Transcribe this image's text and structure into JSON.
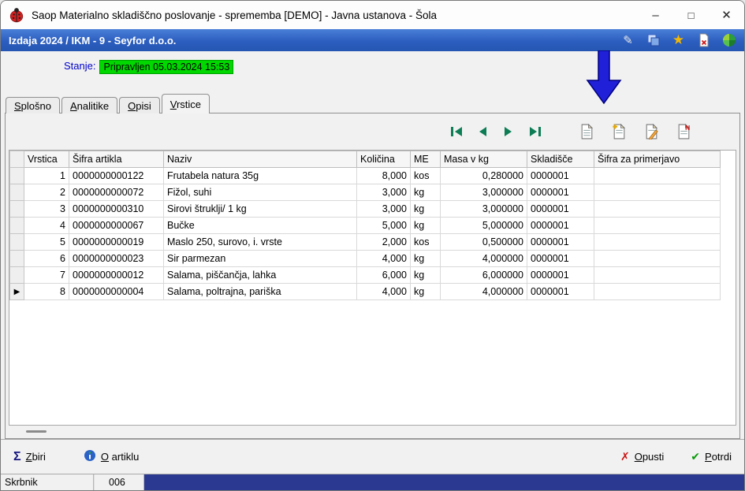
{
  "window": {
    "title": "Saop Materialno skladiščno poslovanje - sprememba [DEMO] - Javna ustanova - Šola",
    "controls": {
      "minimize": "–",
      "maximize": "□",
      "close": "✕"
    }
  },
  "header": {
    "title": "Izdaja 2024 / IKM - 9 - Seyfor d.o.o."
  },
  "state": {
    "label": "Stanje:",
    "value": "Pripravljen 05.03.2024 15:53"
  },
  "tabs": [
    {
      "label": "Splošno",
      "active": false
    },
    {
      "label": "Analitike",
      "active": false
    },
    {
      "label": "Opisi",
      "active": false
    },
    {
      "label": "Vrstice",
      "active": true
    }
  ],
  "table": {
    "columns": [
      {
        "label": "Vrstica",
        "align": "right"
      },
      {
        "label": "Šifra artikla",
        "align": "left"
      },
      {
        "label": "Naziv",
        "align": "left"
      },
      {
        "label": "Količina",
        "align": "right"
      },
      {
        "label": "ME",
        "align": "left"
      },
      {
        "label": "Masa v kg",
        "align": "right"
      },
      {
        "label": "Skladišče",
        "align": "left"
      },
      {
        "label": "Šifra za primerjavo",
        "align": "left"
      }
    ],
    "rows": [
      [
        "1",
        "0000000000122",
        "Frutabela natura 35g",
        "8,000",
        "kos",
        "0,280000",
        "0000001",
        ""
      ],
      [
        "2",
        "0000000000072",
        "Fižol, suhi",
        "3,000",
        "kg",
        "3,000000",
        "0000001",
        ""
      ],
      [
        "3",
        "0000000000310",
        "Sirovi štruklji/ 1 kg",
        "3,000",
        "kg",
        "3,000000",
        "0000001",
        ""
      ],
      [
        "4",
        "0000000000067",
        "Bučke",
        "5,000",
        "kg",
        "5,000000",
        "0000001",
        ""
      ],
      [
        "5",
        "0000000000019",
        "Maslo 250, surovo, i. vrste",
        "2,000",
        "kos",
        "0,500000",
        "0000001",
        ""
      ],
      [
        "6",
        "0000000000023",
        "Sir parmezan",
        "4,000",
        "kg",
        "4,000000",
        "0000001",
        ""
      ],
      [
        "7",
        "0000000000012",
        "Salama, piščančja, lahka",
        "6,000",
        "kg",
        "6,000000",
        "0000001",
        ""
      ],
      [
        "8",
        "0000000000004",
        "Salama, poltrajna, pariška",
        "4,000",
        "kg",
        "4,000000",
        "0000001",
        ""
      ]
    ],
    "current_row_index": 7,
    "current_row_marker": "▶"
  },
  "footer": {
    "zbiri": "Zbiri",
    "o_artiklu": "O artiklu",
    "opusti": "Opusti",
    "potrdi": "Potrdi"
  },
  "statusbar": {
    "user": "Skrbnik",
    "code": "006"
  },
  "colors": {
    "header_blue": "#2c5ec0",
    "state_green": "#00d800",
    "annotation_arrow_blue": "#2020d8",
    "statusbar_blue": "#2b3a90",
    "nav_arrow_green": "#0c7d55"
  }
}
